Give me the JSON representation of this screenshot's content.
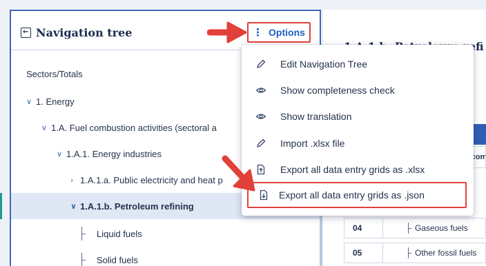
{
  "left_panel": {
    "title": "Navigation tree",
    "options_label": "Options"
  },
  "tree": [
    {
      "label": "Sectors/Totals",
      "chevron": ""
    },
    {
      "label": "1. Energy",
      "chevron": "∨"
    },
    {
      "label": "1.A. Fuel combustion activities (sectoral a",
      "chevron": "∨"
    },
    {
      "label": "1.A.1. Energy industries",
      "chevron": "∨"
    },
    {
      "label": "1.A.1.a. Public electricity and heat p",
      "chevron": "›"
    },
    {
      "label": "1.A.1.b. Petroleum refining",
      "chevron": "∨",
      "selected": true
    },
    {
      "label": "Liquid fuels",
      "chevron": ""
    },
    {
      "label": "Solid fuels",
      "chevron": ""
    }
  ],
  "right_panel": {
    "title": "1.A.1.b. Petroleum refi",
    "column_header": "Fuel combustion",
    "rows": [
      {
        "code": "04",
        "label": "Gaseous fuels"
      },
      {
        "code": "05",
        "label": "Other fossil fuels"
      }
    ]
  },
  "menu": {
    "items": [
      {
        "label": "Edit Navigation Tree",
        "icon": "pencil-icon"
      },
      {
        "label": "Show completeness check",
        "icon": "eye-icon"
      },
      {
        "label": "Show translation",
        "icon": "eye-icon"
      },
      {
        "label": "Import .xlsx file",
        "icon": "pencil-icon"
      },
      {
        "label": "Export all data entry grids as .xlsx",
        "icon": "file-export-icon"
      },
      {
        "label": "Export all data entry grids as .json",
        "icon": "file-export-icon",
        "highlighted": true
      }
    ]
  },
  "colors": {
    "accent_blue": "#1a5fc4",
    "panel_border": "#3f68b5",
    "highlight_red": "#e2403a",
    "selected_row": "#dfe7f5"
  }
}
